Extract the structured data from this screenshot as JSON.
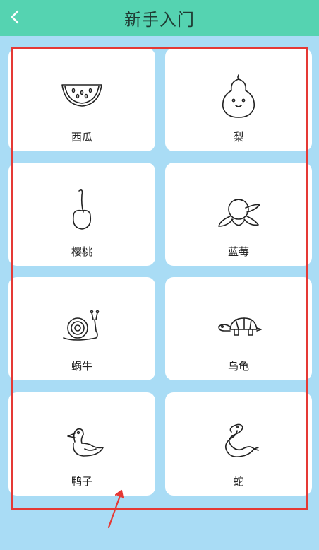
{
  "header": {
    "title": "新手入门",
    "back_icon": "chevron-left-icon",
    "background": "#55d3b1"
  },
  "background_color": "#a9dcf5",
  "highlight_color": "#e53935",
  "cards": [
    {
      "label": "西瓜",
      "icon": "watermelon-icon"
    },
    {
      "label": "梨",
      "icon": "pear-icon"
    },
    {
      "label": "樱桃",
      "icon": "cherry-icon"
    },
    {
      "label": "蓝莓",
      "icon": "blueberry-icon"
    },
    {
      "label": "蜗牛",
      "icon": "snail-icon"
    },
    {
      "label": "乌龟",
      "icon": "turtle-icon"
    },
    {
      "label": "鸭子",
      "icon": "duck-icon"
    },
    {
      "label": "蛇",
      "icon": "snake-icon"
    }
  ]
}
